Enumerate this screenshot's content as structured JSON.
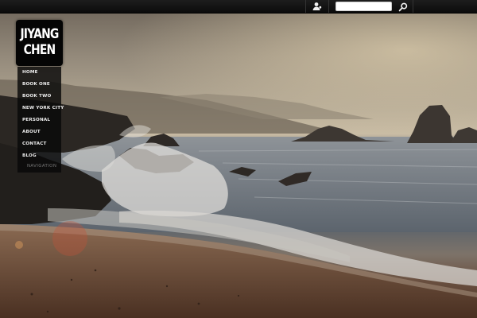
{
  "site": {
    "logo_line1": "JIYANG",
    "logo_line2": "CHEN"
  },
  "topbar": {
    "user_icon": "user-icon",
    "search_placeholder": "",
    "search_icon": "search-icon"
  },
  "nav": {
    "items": [
      {
        "label": "HOME"
      },
      {
        "label": "BOOK ONE"
      },
      {
        "label": "BOOK TWO"
      },
      {
        "label": "NEW YORK CITY"
      },
      {
        "label": "PERSONAL"
      },
      {
        "label": "ABOUT"
      },
      {
        "label": "CONTACT"
      },
      {
        "label": "BLOG"
      }
    ],
    "caption": "NAVIGATION"
  }
}
